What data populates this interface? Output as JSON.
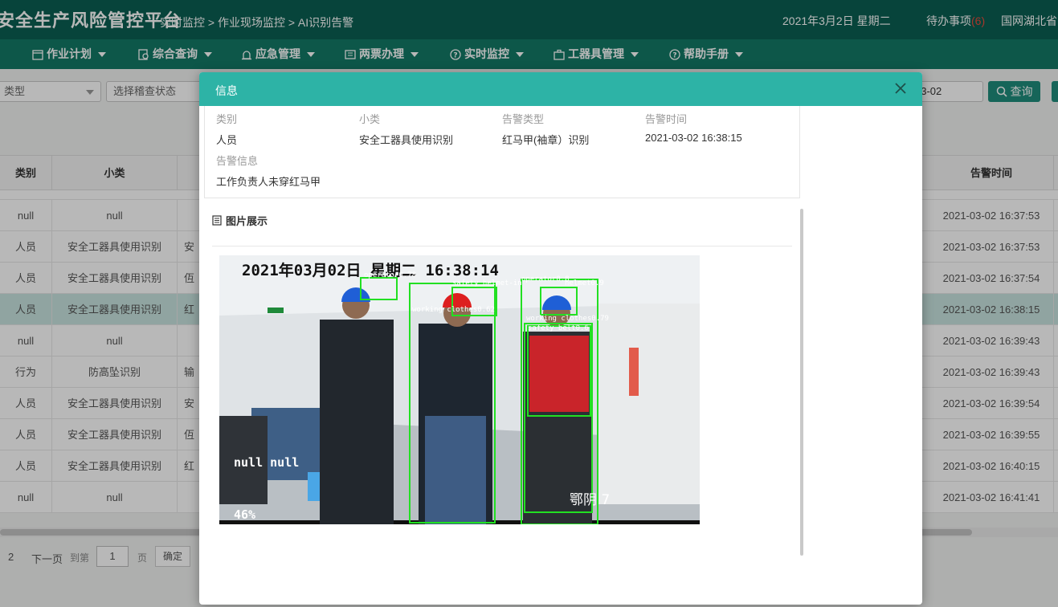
{
  "header": {
    "app_title": "安全生产风险管控平台",
    "breadcrumb": "实时监控 > 作业现场监控 > AI识别告警",
    "date": "2021年3月2日  星期二",
    "todo_label": "待办事项",
    "todo_count": "(6)",
    "org": "国网湖北省"
  },
  "nav": [
    "作业计划",
    "综合查询",
    "应急管理",
    "两票办理",
    "实时监控",
    "工器具管理",
    "帮助手册"
  ],
  "filters": {
    "type_placeholder": "类型",
    "status_placeholder": "选择稽查状态",
    "date_value": "03-02",
    "query_label": "查询"
  },
  "table": {
    "col_category": "类别",
    "col_subclass": "小类",
    "col_time": "告警时间",
    "rows": [
      {
        "category": "null",
        "subclass": "null",
        "third": "",
        "time": "2021-03-02 16:37:53"
      },
      {
        "category": "人员",
        "subclass": "安全工器具使用识别",
        "third": "安",
        "time": "2021-03-02 16:37:53"
      },
      {
        "category": "人员",
        "subclass": "安全工器具使用识别",
        "third": "仾",
        "time": "2021-03-02 16:37:54"
      },
      {
        "category": "人员",
        "subclass": "安全工器具使用识别",
        "third": "红",
        "time": "2021-03-02 16:38:15"
      },
      {
        "category": "null",
        "subclass": "null",
        "third": "",
        "time": "2021-03-02 16:39:43"
      },
      {
        "category": "行为",
        "subclass": "防高坠识别",
        "third": "输",
        "time": "2021-03-02 16:39:43"
      },
      {
        "category": "人员",
        "subclass": "安全工器具使用识别",
        "third": "安",
        "time": "2021-03-02 16:39:54"
      },
      {
        "category": "人员",
        "subclass": "安全工器具使用识别",
        "third": "仾",
        "time": "2021-03-02 16:39:55"
      },
      {
        "category": "人员",
        "subclass": "安全工器具使用识别",
        "third": "红",
        "time": "2021-03-02 16:40:15"
      },
      {
        "category": "null",
        "subclass": "null",
        "third": "",
        "time": "2021-03-02 16:41:41"
      }
    ],
    "selected_row": 3
  },
  "pager": {
    "page_2": "2",
    "next": "下一页",
    "goto": "到第",
    "page_input": "1",
    "page_unit": "页",
    "confirm": "确定"
  },
  "modal": {
    "title": "信息",
    "labels": {
      "category": "类别",
      "subclass": "小类",
      "alarm_type": "告警类型",
      "alarm_time": "告警时间",
      "alarm_info": "告警信息"
    },
    "values": {
      "category": "人员",
      "subclass": "安全工器具使用识别",
      "alarm_type": "红马甲(袖章）识别",
      "alarm_time": "2021-03-02 16:38:15",
      "alarm_info": "工作负责人未穿红马甲"
    },
    "picture_section": "图片展示",
    "photo": {
      "timestamp": "2021年03月02日  星期二  16:38:14",
      "overlay_left": "null   null",
      "percent": "46%",
      "corner_text": "鄂阴 7",
      "detections": [
        "operator0.78",
        "safety helmet-in",
        "operator0.8",
        "helmet0.9",
        "working clothes0.62",
        "working clothes0.79",
        "safety belt0.6"
      ]
    }
  },
  "colors": {
    "header": "#0b5f52",
    "nav": "#127966",
    "modal_header": "#2db3a6",
    "selected_row": "#c8e4df",
    "detection_box": "#22e022",
    "todo_count": "#e74c3c"
  }
}
